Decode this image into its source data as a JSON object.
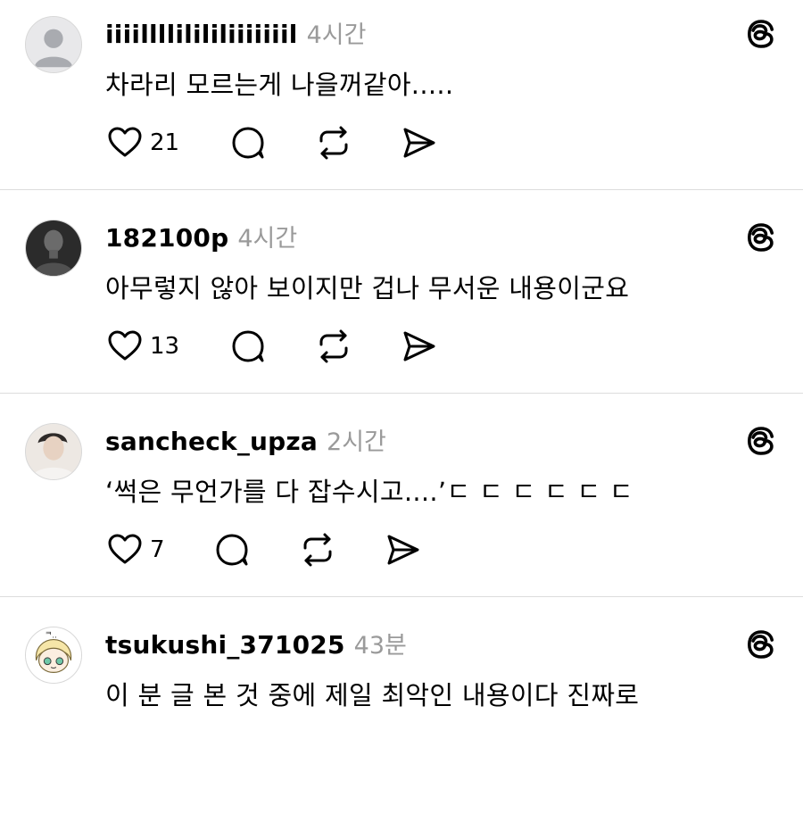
{
  "posts": [
    {
      "username": "iiiillllilililiiiiiiil",
      "time": "4시간",
      "text": "차라리 모르는게 나을꺼같아.....",
      "likes": "21",
      "avatar_icon": "default-person-avatar"
    },
    {
      "username": "182100p",
      "time": "4시간",
      "text": "아무렇지 않아 보이지만 겁나 무서운 내용이군요",
      "likes": "13",
      "avatar_icon": "dark-portrait-avatar"
    },
    {
      "username": "sancheck_upza",
      "time": "2시간",
      "text": "‘썩은 무언가를 다 잡수시고....’ㄷ ㄷ ㄷ ㄷ ㄷ ㄷ",
      "likes": "7",
      "avatar_icon": "person-photo-avatar"
    },
    {
      "username": "tsukushi_371025",
      "time": "43분",
      "text": "이 분 글 본 것 중에 제일 최악인 내용이다 진짜로",
      "avatar_icon": "cartoon-character-avatar"
    }
  ],
  "icons": {
    "like": "heart-icon",
    "reply": "reply-bubble-icon",
    "repost": "repost-icon",
    "share": "send-icon",
    "brand": "threads-logo-icon"
  }
}
